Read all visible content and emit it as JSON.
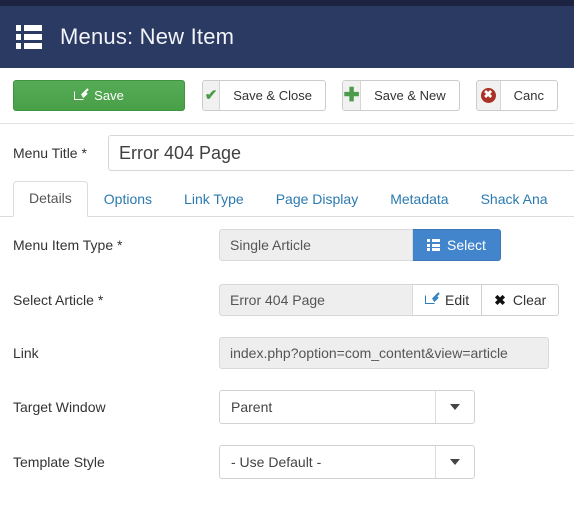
{
  "header": {
    "icon": "list-icon",
    "title": "Menus: New Item",
    "bg_color": "#2b3a63"
  },
  "toolbar": {
    "save": {
      "label": "Save",
      "icon": "pencil-square-icon",
      "color": "#4ca64c"
    },
    "save_close": {
      "label": "Save & Close",
      "icon": "check-icon"
    },
    "save_new": {
      "label": "Save & New",
      "icon": "plus-icon"
    },
    "cancel": {
      "label": "Canc",
      "icon": "cancel-circle-icon"
    }
  },
  "menu_title": {
    "label": "Menu Title *",
    "value": "Error 404 Page",
    "placeholder": ""
  },
  "tabs": [
    {
      "label": "Details",
      "active": true
    },
    {
      "label": "Options",
      "active": false
    },
    {
      "label": "Link Type",
      "active": false
    },
    {
      "label": "Page Display",
      "active": false
    },
    {
      "label": "Metadata",
      "active": false
    },
    {
      "label": "Shack Ana",
      "active": false
    }
  ],
  "fields": {
    "menu_item_type": {
      "label": "Menu Item Type *",
      "value": "Single Article",
      "button": {
        "label": "Select",
        "icon": "list-icon",
        "color": "#4285cc"
      }
    },
    "select_article": {
      "label": "Select Article *",
      "value": "Error 404 Page",
      "edit_button": {
        "label": "Edit",
        "icon": "pencil-square-icon"
      },
      "clear_button": {
        "label": "Clear",
        "icon": "x-icon"
      }
    },
    "link": {
      "label": "Link",
      "value": "index.php?option=com_content&view=article"
    },
    "target_window": {
      "label": "Target Window",
      "value": "Parent",
      "icon": "chevron-down-icon"
    },
    "template_style": {
      "label": "Template Style",
      "value": "- Use Default -",
      "icon": "chevron-down-icon"
    }
  }
}
